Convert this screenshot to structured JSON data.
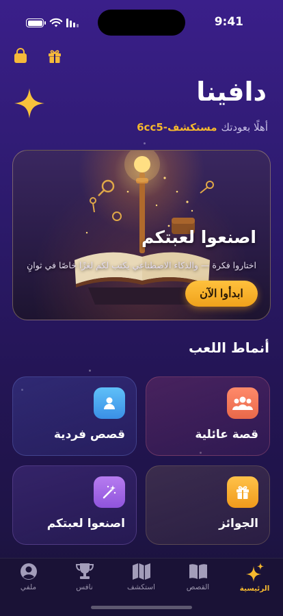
{
  "status": {
    "time": "9:41"
  },
  "header": {
    "title": "دافينا",
    "welcome_text": "أهلًا بعودتك",
    "username": "مستكشف-6cc5",
    "icons": [
      "shopping-bag-icon",
      "gift-icon",
      "sparkle-icon"
    ]
  },
  "hero": {
    "title": "اصنعوا لعبتكم",
    "subtitle": "اختاروا فكرة — والذكاء الاصطناعي يكتب لكم لغزًا خاصًا في ثوانٍ",
    "button_label": "ابدأوا الآن"
  },
  "modes": {
    "section_title": "أنماط اللعب",
    "items": [
      {
        "label": "قصة عائلية",
        "icon": "group-icon",
        "color": "#f07a5a"
      },
      {
        "label": "قصص فردية",
        "icon": "person-icon",
        "color": "#4aa9ef"
      },
      {
        "label": "الجوائز",
        "icon": "gift-icon",
        "color": "#f4a623"
      },
      {
        "label": "اصنعوا لعبتكم",
        "icon": "magic-wand-icon",
        "color": "#a765e8"
      }
    ]
  },
  "tabbar": {
    "items": [
      {
        "label": "الرئيسية",
        "icon": "sparkle-icon",
        "active": true
      },
      {
        "label": "القصص",
        "icon": "book-icon",
        "active": false
      },
      {
        "label": "استكشف",
        "icon": "map-icon",
        "active": false
      },
      {
        "label": "نافس",
        "icon": "trophy-icon",
        "active": false
      },
      {
        "label": "ملفي",
        "icon": "profile-icon",
        "active": false
      }
    ]
  },
  "colors": {
    "accent": "#f5b82e",
    "background": "#2c1a6b"
  }
}
